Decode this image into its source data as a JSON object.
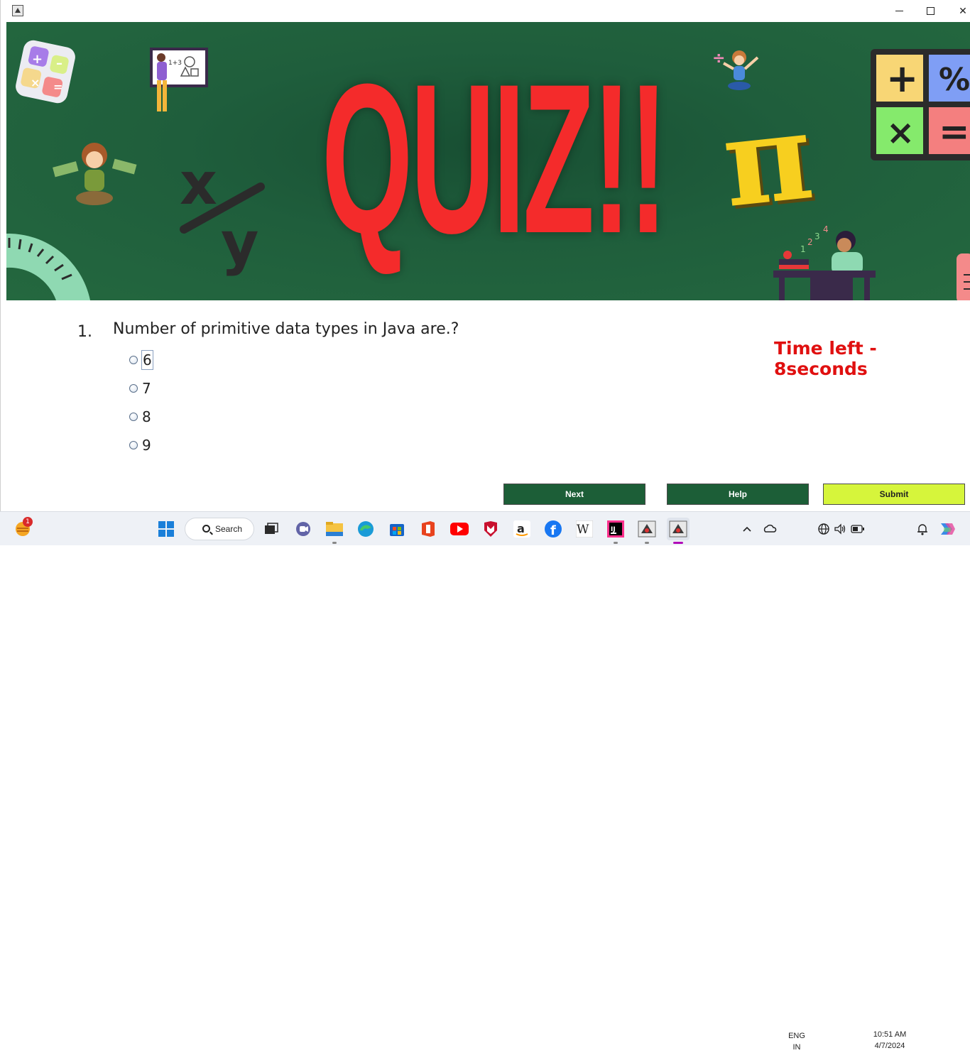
{
  "window": {
    "minimize_icon": "minimize-icon",
    "maximize_icon": "maximize-icon",
    "close_icon": "close-icon",
    "close_glyph": "✕"
  },
  "banner": {
    "title": "QUIZ!!",
    "math_symbol": "π"
  },
  "question": {
    "number": "1.",
    "text": "Number of primitive data types in Java are.?"
  },
  "options": [
    {
      "label": "6",
      "selected": false,
      "focused": true
    },
    {
      "label": "7",
      "selected": false,
      "focused": false
    },
    {
      "label": "8",
      "selected": false,
      "focused": false
    },
    {
      "label": "9",
      "selected": false,
      "focused": false
    }
  ],
  "timer": {
    "text": "Time left - 8seconds",
    "color": "#e01010"
  },
  "buttons": {
    "next": "Next",
    "help": "Help",
    "submit": "Submit"
  },
  "colors": {
    "banner": "#1f5e3c",
    "button_dark": "#1c5e37",
    "button_submit": "#d6f53b",
    "quiz_red": "#f42b2b"
  },
  "taskbar": {
    "search_label": "Search",
    "weather_badge": "1",
    "apps": [
      "windows-start-icon",
      "task-view-icon",
      "teams-chat-icon",
      "file-explorer-icon",
      "edge-icon",
      "store-icon",
      "office-icon",
      "youtube-icon",
      "mcafee-icon",
      "amazon-icon",
      "facebook-icon",
      "wikipedia-icon",
      "intellij-icon",
      "java-app-icon",
      "java-app-active-icon"
    ],
    "language": "ENG",
    "region": "IN",
    "time": "10:51 AM",
    "date": "4/7/2024"
  }
}
